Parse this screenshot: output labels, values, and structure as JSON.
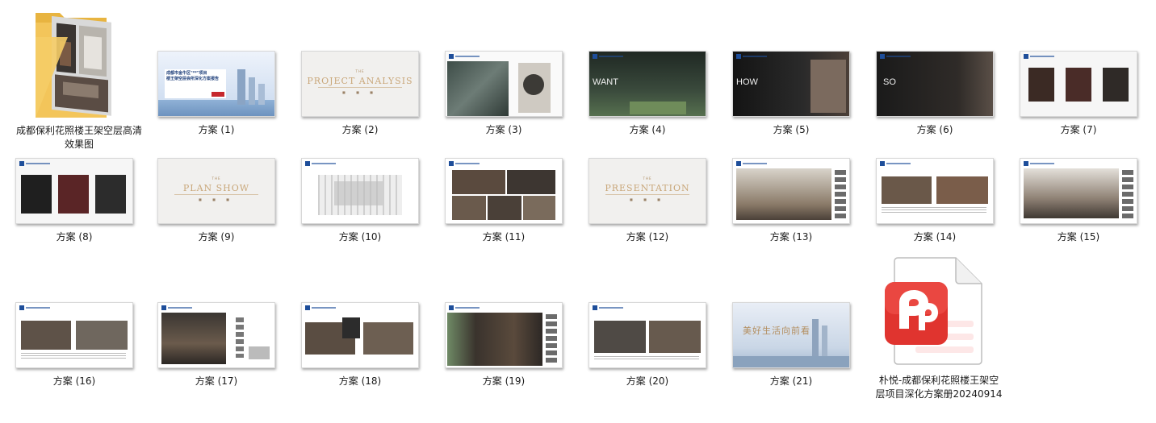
{
  "folder": {
    "label": "成都保利花照楼王架空层高清效果图",
    "icon": "folder-icon"
  },
  "file": {
    "label": "朴悦-成都保利花照楼王架空层项目深化方案册20240914",
    "icon": "wps-pdf-icon",
    "accent": "#e0342f"
  },
  "items": [
    {
      "label": "方案 (1)"
    },
    {
      "label": "方案 (2)",
      "title": "PROJECT ANALYSIS"
    },
    {
      "label": "方案 (3)"
    },
    {
      "label": "方案 (4)",
      "word": "WANT"
    },
    {
      "label": "方案 (5)",
      "word": "HOW"
    },
    {
      "label": "方案 (6)",
      "word": "SO"
    },
    {
      "label": "方案 (7)"
    },
    {
      "label": "方案 (8)"
    },
    {
      "label": "方案 (9)",
      "title": "PLAN SHOW"
    },
    {
      "label": "方案 (10)"
    },
    {
      "label": "方案 (11)"
    },
    {
      "label": "方案 (12)",
      "title": "PRESENTATION"
    },
    {
      "label": "方案 (13)"
    },
    {
      "label": "方案 (14)"
    },
    {
      "label": "方案 (15)"
    },
    {
      "label": "方案 (16)"
    },
    {
      "label": "方案 (17)"
    },
    {
      "label": "方案 (18)"
    },
    {
      "label": "方案 (19)"
    },
    {
      "label": "方案 (20)"
    },
    {
      "label": "方案 (21)"
    }
  ],
  "thumb_text": {
    "cover1_title": "成都市金牛区\"**\"项目\n楼王架空层会所深化方案报告",
    "the": "THE",
    "cover21_title": "美好生活向前看"
  }
}
